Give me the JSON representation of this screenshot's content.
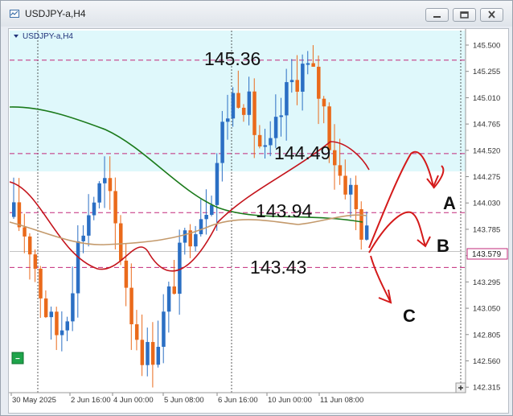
{
  "window": {
    "title": "USDJPY-a,H4"
  },
  "chart": {
    "symbol_label": "USDJPY-a,H4",
    "current_price": "143.579",
    "y_axis_ticks": [
      "145.500",
      "145.255",
      "145.010",
      "144.765",
      "144.520",
      "144.275",
      "144.030",
      "143.785",
      "143.540",
      "143.295",
      "143.050",
      "142.805",
      "142.560",
      "142.315"
    ],
    "x_axis_ticks": [
      "30 May 2025",
      "2 Jun 16:00",
      "4 Jun 00:00",
      "5 Jun 08:00",
      "6 Jun 16:00",
      "10 Jun 00:00",
      "11 Jun 08:00"
    ],
    "levels": [
      {
        "label": "145.36",
        "price": 145.36
      },
      {
        "label": "144.49",
        "price": 144.49
      },
      {
        "label": "143.94",
        "price": 143.94
      },
      {
        "label": "143.43",
        "price": 143.43
      }
    ],
    "scenarios": [
      "A",
      "B",
      "C"
    ],
    "colors": {
      "bull": "#2b6fc4",
      "bear": "#ea6a1b",
      "ma_red": "#c4141c",
      "ma_green": "#1b7a1b",
      "ma_tan": "#c49a6c",
      "level_line": "#c2287a",
      "zone": "#dff8fb",
      "arrow": "#d41a1a"
    },
    "icons": [
      "chart-trading-toggle-icon",
      "expand-plus-icon"
    ]
  }
}
